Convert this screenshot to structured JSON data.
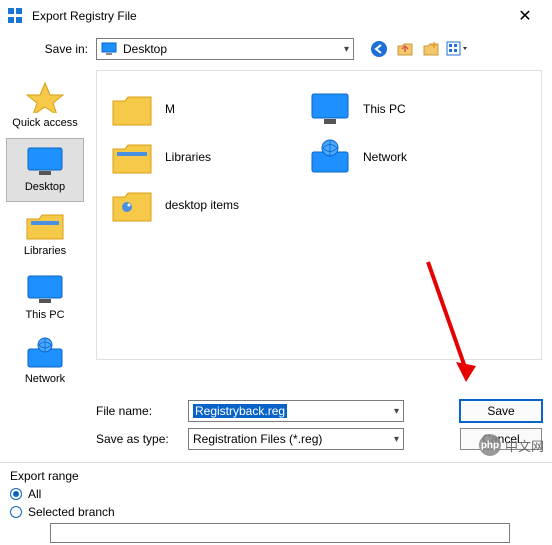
{
  "window": {
    "title": "Export Registry File"
  },
  "saveIn": {
    "label": "Save in:",
    "location": "Desktop"
  },
  "places": {
    "quickAccess": "Quick access",
    "desktop": "Desktop",
    "libraries": "Libraries",
    "thisPC": "This PC",
    "network": "Network"
  },
  "fileListing": {
    "m": "M",
    "thisPC": "This PC",
    "libraries": "Libraries",
    "network": "Network",
    "desktopItems": "desktop items"
  },
  "fileName": {
    "label": "File name:",
    "value": "Registryback.reg"
  },
  "saveAsType": {
    "label": "Save as type:",
    "value": "Registration Files (*.reg)"
  },
  "buttons": {
    "save": "Save",
    "cancel": "Cancel"
  },
  "exportRange": {
    "legend": "Export range",
    "all": "All",
    "selectedBranch": "Selected branch"
  },
  "watermark": {
    "logo": "php",
    "text": "中文网"
  }
}
